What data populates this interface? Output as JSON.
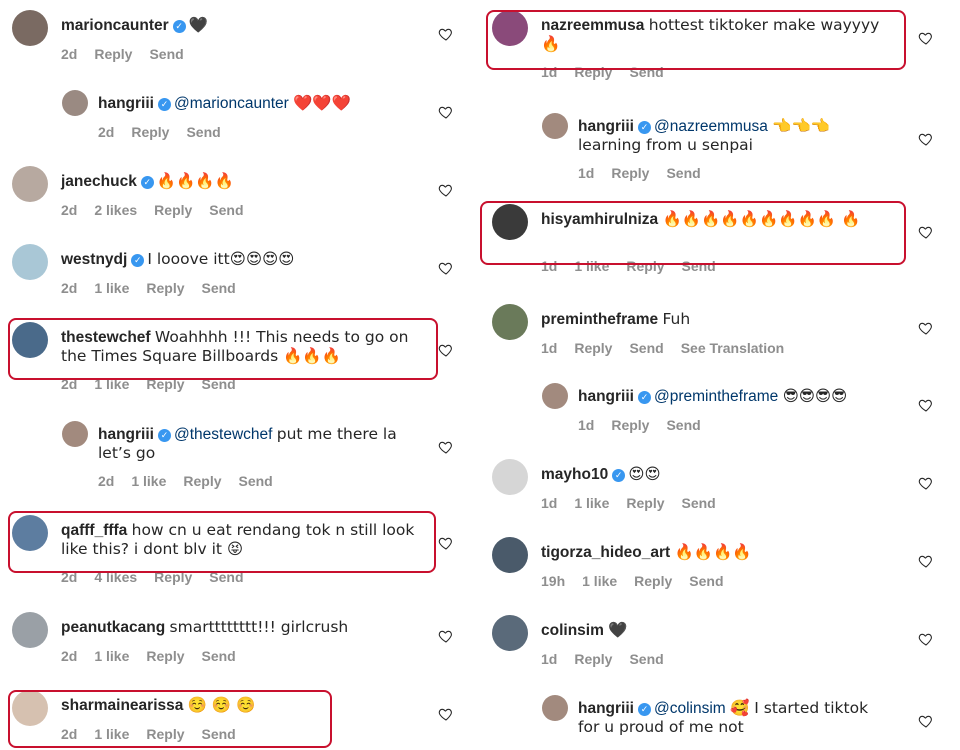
{
  "left": [
    {
      "username": "marioncaunter",
      "verified": true,
      "text": "🖤",
      "mention": "",
      "time": "2d",
      "likes": "",
      "reply": "Reply",
      "send": "Send",
      "reply_level": false,
      "lines": 1
    },
    {
      "username": "hangriii",
      "verified": true,
      "mention": "@marioncaunter",
      "text": "❤️❤️❤️",
      "time": "2d",
      "likes": "",
      "reply": "Reply",
      "send": "Send",
      "reply_level": true,
      "lines": 1
    },
    {
      "username": "janechuck",
      "verified": true,
      "mention": "",
      "text": "🔥🔥🔥🔥",
      "time": "2d",
      "likes": "2 likes",
      "reply": "Reply",
      "send": "Send",
      "reply_level": false,
      "lines": 1
    },
    {
      "username": "westnydj",
      "verified": true,
      "mention": "",
      "text": "I looove itt😍😍😍😍",
      "time": "2d",
      "likes": "1 like",
      "reply": "Reply",
      "send": "Send",
      "reply_level": false,
      "lines": 1
    },
    {
      "username": "thestewchef",
      "verified": false,
      "mention": "",
      "text": "Woahhhh !!! This needs to go on the Times Square Billboards 🔥🔥🔥",
      "time": "2d",
      "likes": "1 like",
      "reply": "Reply",
      "send": "Send",
      "reply_level": false,
      "lines": 2
    },
    {
      "username": "hangriii",
      "verified": true,
      "mention": "@thestewchef",
      "text": "put me there la let’s go",
      "time": "2d",
      "likes": "1 like",
      "reply": "Reply",
      "send": "Send",
      "reply_level": true,
      "lines": 2
    },
    {
      "username": "qafff_fffa",
      "verified": false,
      "mention": "",
      "text": "how cn u eat rendang tok n still look like this? i dont blv it 😝",
      "time": "2d",
      "likes": "4 likes",
      "reply": "Reply",
      "send": "Send",
      "reply_level": false,
      "lines": 2
    },
    {
      "username": "peanutkacang",
      "verified": false,
      "mention": "",
      "text": "smartttttttt!!! girlcrush",
      "time": "2d",
      "likes": "1 like",
      "reply": "Reply",
      "send": "Send",
      "reply_level": false,
      "lines": 1
    },
    {
      "username": "sharmainearissa",
      "verified": false,
      "mention": "",
      "text": "☺️ ☺️ ☺️",
      "time": "2d",
      "likes": "1 like",
      "reply": "Reply",
      "send": "Send",
      "reply_level": false,
      "lines": 1
    }
  ],
  "right": [
    {
      "username": "nazreemmusa",
      "verified": false,
      "mention": "",
      "text": "hottest tiktoker make wayyyy 🔥",
      "time": "1d",
      "likes": "",
      "reply": "Reply",
      "send": "Send",
      "reply_level": false,
      "lines": 2
    },
    {
      "username": "hangriii",
      "verified": true,
      "mention": "@nazreemmusa",
      "text": "👈👈👈 learning from u senpai",
      "time": "1d",
      "likes": "",
      "reply": "Reply",
      "send": "Send",
      "reply_level": true,
      "lines": 2
    },
    {
      "username": "hisyamhirulniza",
      "verified": false,
      "mention": "",
      "text": "🔥🔥🔥🔥🔥🔥🔥🔥🔥 🔥",
      "time": "1d",
      "likes": "1 like",
      "reply": "Reply",
      "send": "Send",
      "reply_level": false,
      "lines": 2
    },
    {
      "username": "premintheframe",
      "verified": false,
      "mention": "",
      "text": "Fuh",
      "time": "1d",
      "likes": "",
      "reply": "Reply",
      "send": "Send",
      "extra": "See Translation",
      "reply_level": false,
      "lines": 1
    },
    {
      "username": "hangriii",
      "verified": true,
      "mention": "@premintheframe",
      "text": "😎😎😎😎",
      "time": "1d",
      "likes": "",
      "reply": "Reply",
      "send": "Send",
      "reply_level": true,
      "lines": 1
    },
    {
      "username": "mayho10",
      "verified": true,
      "mention": "",
      "text": "😍😍",
      "time": "1d",
      "likes": "1 like",
      "reply": "Reply",
      "send": "Send",
      "reply_level": false,
      "lines": 1
    },
    {
      "username": "tigorza_hideo_art",
      "verified": false,
      "mention": "",
      "text": "🔥🔥🔥🔥",
      "time": "19h",
      "likes": "1 like",
      "reply": "Reply",
      "send": "Send",
      "reply_level": false,
      "lines": 1
    },
    {
      "username": "colinsim",
      "verified": false,
      "mention": "",
      "text": "🖤",
      "time": "1d",
      "likes": "",
      "reply": "Reply",
      "send": "Send",
      "reply_level": false,
      "lines": 1
    },
    {
      "username": "hangriii",
      "verified": true,
      "mention": "@colinsim",
      "text": "🥰 I started tiktok for u proud of me not",
      "time": "",
      "likes": "",
      "reply": "",
      "send": "",
      "reply_level": true,
      "lines": 2
    }
  ]
}
